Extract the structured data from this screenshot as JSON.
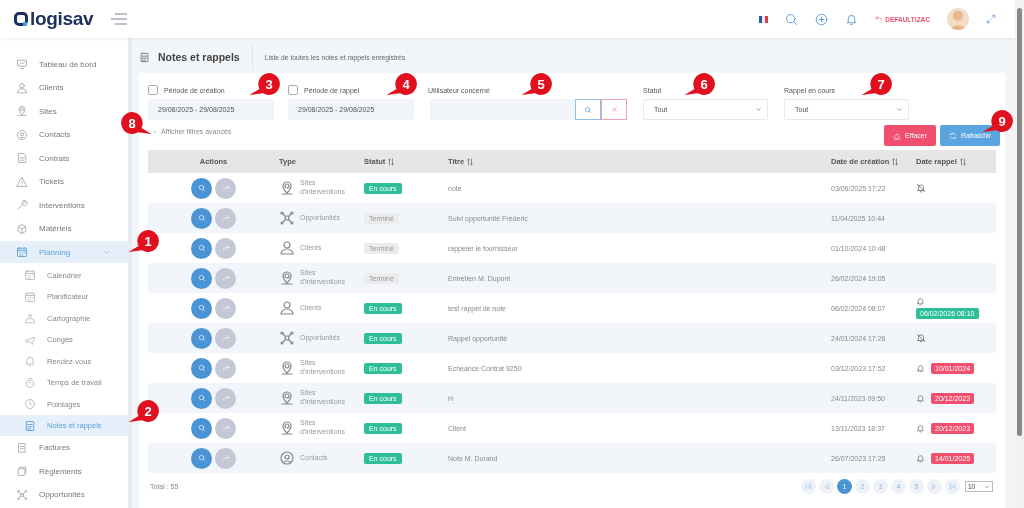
{
  "header": {
    "logo": "logisav",
    "user": "DEFAULT\\ZAC"
  },
  "sidebar": {
    "items": [
      {
        "label": "Tableau de bord",
        "selected": false
      },
      {
        "label": "Clients",
        "selected": false
      },
      {
        "label": "Sites",
        "selected": false
      },
      {
        "label": "Contacts",
        "selected": false
      },
      {
        "label": "Contrats",
        "selected": false
      },
      {
        "label": "Tickets",
        "selected": false
      },
      {
        "label": "Interventions",
        "selected": false
      },
      {
        "label": "Matériels",
        "selected": false
      },
      {
        "label": "Planning",
        "selected": true,
        "expanded": true,
        "children": [
          {
            "label": "Calendrier",
            "selected": false
          },
          {
            "label": "Planificateur",
            "selected": false
          },
          {
            "label": "Cartographie",
            "selected": false
          },
          {
            "label": "Congés",
            "selected": false
          },
          {
            "label": "Rendez-vous",
            "selected": false
          },
          {
            "label": "Temps de travail",
            "selected": false
          },
          {
            "label": "Pointages",
            "selected": false
          },
          {
            "label": "Notes et rappels",
            "selected": true
          }
        ]
      },
      {
        "label": "Factures",
        "selected": false
      },
      {
        "label": "Règlements",
        "selected": false
      },
      {
        "label": "Opportunités",
        "selected": false
      }
    ]
  },
  "page": {
    "title": "Notes et rappels",
    "subtitle": "Liste de toutes les notes et rappels enregistrés"
  },
  "filters": {
    "creation": {
      "label": "Période de création",
      "checked": false,
      "value": "29/08/2025 - 29/08/2025"
    },
    "reminder": {
      "label": "Période de rappel",
      "checked": false,
      "value": "29/08/2025 - 29/08/2025"
    },
    "user": {
      "label": "Utilisateur concerné"
    },
    "status": {
      "label": "Statut",
      "value": "Tout"
    },
    "reminder_active": {
      "label": "Rappel en cours",
      "value": "Tout"
    },
    "advanced_link": "Afficher filtres avancés",
    "buttons": [
      {
        "label": "Effacer",
        "kind": "clear"
      },
      {
        "label": "Rafraichir",
        "kind": "refresh"
      }
    ]
  },
  "table": {
    "columns": [
      {
        "label": "Actions",
        "sortable": false
      },
      {
        "label": "Type",
        "sortable": false
      },
      {
        "label": "Statut",
        "sortable": true
      },
      {
        "label": "Titre",
        "sortable": true
      },
      {
        "label": "Date de création",
        "sortable": true
      },
      {
        "label": "Date rappel",
        "sortable": true
      }
    ],
    "rows": [
      {
        "type": {
          "kind": "site",
          "label": "Sites d'interventions"
        },
        "status": {
          "kind": "active",
          "label": "En cours"
        },
        "title": "note",
        "created": "03/06/2025 17:22",
        "reminder": {
          "kind": "muted"
        }
      },
      {
        "type": {
          "kind": "opportunity",
          "label": "Opportunités"
        },
        "status": {
          "kind": "done",
          "label": "Terminé"
        },
        "title": "Suivi opportunité Frederic",
        "created": "11/04/2025 10:44",
        "reminder": {
          "kind": "none"
        }
      },
      {
        "type": {
          "kind": "client",
          "label": "Clients"
        },
        "status": {
          "kind": "done",
          "label": "Terminé"
        },
        "title": "rappeler le fournisseur",
        "created": "01/10/2024 10:48",
        "reminder": {
          "kind": "none"
        }
      },
      {
        "type": {
          "kind": "site",
          "label": "Sites d'interventions"
        },
        "status": {
          "kind": "done",
          "label": "Terminé"
        },
        "title": "Entretien M. Dupont",
        "created": "26/02/2024 19:05",
        "reminder": {
          "kind": "none"
        }
      },
      {
        "type": {
          "kind": "client",
          "label": "Clients"
        },
        "status": {
          "kind": "active",
          "label": "En cours"
        },
        "title": "test rappel de note",
        "created": "06/02/2024 08:07",
        "reminder": {
          "kind": "date",
          "date": "06/02/2026 08:10",
          "color": "#2ebf9a"
        }
      },
      {
        "type": {
          "kind": "opportunity",
          "label": "Opportunités"
        },
        "status": {
          "kind": "active",
          "label": "En cours"
        },
        "title": "Rappel opportunité",
        "created": "24/01/2024 17:26",
        "reminder": {
          "kind": "muted"
        }
      },
      {
        "type": {
          "kind": "site",
          "label": "Sites d'interventions"
        },
        "status": {
          "kind": "active",
          "label": "En cours"
        },
        "title": "Echeance Contrat 9250",
        "created": "03/12/2023 17:52",
        "reminder": {
          "kind": "date",
          "date": "10/01/2024",
          "color": "#f0506e"
        }
      },
      {
        "type": {
          "kind": "site",
          "label": "Sites d'interventions"
        },
        "status": {
          "kind": "active",
          "label": "En cours"
        },
        "title": "H",
        "created": "24/11/2023 09:50",
        "reminder": {
          "kind": "date",
          "date": "20/12/2023",
          "color": "#f0506e"
        }
      },
      {
        "type": {
          "kind": "site",
          "label": "Sites d'interventions"
        },
        "status": {
          "kind": "active",
          "label": "En cours"
        },
        "title": "Client",
        "created": "13/11/2023 18:37",
        "reminder": {
          "kind": "date",
          "date": "20/12/2023",
          "color": "#f0506e"
        }
      },
      {
        "type": {
          "kind": "contact",
          "label": "Contacts"
        },
        "status": {
          "kind": "active",
          "label": "En cours"
        },
        "title": "Note M. Durand",
        "created": "26/07/2023 17:25",
        "reminder": {
          "kind": "date",
          "date": "14/01/2025",
          "color": "#f0506e"
        }
      }
    ]
  },
  "footer": {
    "total": "Total : 55",
    "pages": [
      {
        "label": "1",
        "selected": true
      },
      {
        "label": "2",
        "selected": false
      },
      {
        "label": "3",
        "selected": false
      },
      {
        "label": "4",
        "selected": false
      },
      {
        "label": "5",
        "selected": false
      }
    ],
    "page_size": "10"
  },
  "callouts": [
    {
      "label": "1"
    },
    {
      "label": "2"
    },
    {
      "label": "3"
    },
    {
      "label": "4"
    },
    {
      "label": "5"
    },
    {
      "label": "6"
    },
    {
      "label": "7"
    },
    {
      "label": "8"
    },
    {
      "label": "9"
    }
  ]
}
